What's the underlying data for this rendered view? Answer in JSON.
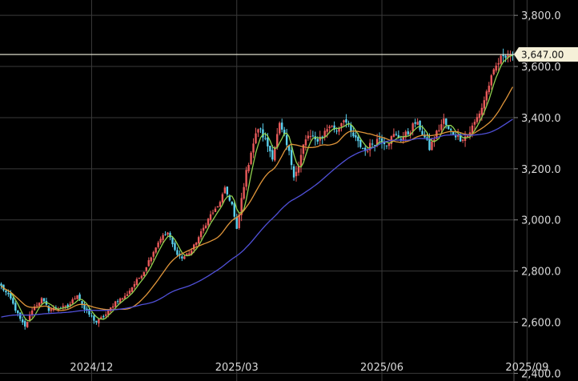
{
  "chart_data": {
    "type": "candlestick",
    "title": "",
    "xlabel": "",
    "ylabel": "",
    "ylim": [
      2370,
      3860
    ],
    "grid": true,
    "y_ticks": [
      {
        "value": 2400,
        "label": "2,400.0"
      },
      {
        "value": 2600,
        "label": "2,600.0"
      },
      {
        "value": 2800,
        "label": "2,800.0"
      },
      {
        "value": 3000,
        "label": "3,000.0"
      },
      {
        "value": 3200,
        "label": "3,200.0"
      },
      {
        "value": 3400,
        "label": "3,400.0"
      },
      {
        "value": 3600,
        "label": "3,600.0"
      },
      {
        "value": 3800,
        "label": "3,800.0"
      }
    ],
    "x_ticks": [
      {
        "label": "2024/12",
        "index": 38
      },
      {
        "label": "2025/03",
        "index": 99
      },
      {
        "label": "2025/06",
        "index": 160
      },
      {
        "label": "2025/09",
        "index": 221
      }
    ],
    "current_price": {
      "value": 3647.0,
      "label": "3,647.00"
    },
    "colors": {
      "up": "#e85a5a",
      "down": "#5ad0ee",
      "ma_short": "#8fd14f",
      "ma_mid": "#e0953a",
      "ma_long": "#5050d8",
      "price_line": "#f2f2e0",
      "price_box": "#f5f0d8"
    },
    "series": [
      {
        "name": "",
        "color": "#8fd14f",
        "window": 5
      },
      {
        "name": "",
        "color": "#e0953a",
        "window": 20
      },
      {
        "name": "",
        "color": "#5050d8",
        "window": 60
      }
    ],
    "price_anchors": [
      [
        0,
        2740
      ],
      [
        4,
        2690
      ],
      [
        8,
        2610
      ],
      [
        10,
        2580
      ],
      [
        13,
        2650
      ],
      [
        17,
        2690
      ],
      [
        20,
        2650
      ],
      [
        28,
        2660
      ],
      [
        32,
        2710
      ],
      [
        35,
        2650
      ],
      [
        40,
        2600
      ],
      [
        44,
        2630
      ],
      [
        48,
        2680
      ],
      [
        52,
        2700
      ],
      [
        56,
        2750
      ],
      [
        60,
        2800
      ],
      [
        63,
        2860
      ],
      [
        67,
        2930
      ],
      [
        70,
        2950
      ],
      [
        73,
        2880
      ],
      [
        76,
        2850
      ],
      [
        80,
        2880
      ],
      [
        84,
        2950
      ],
      [
        88,
        3020
      ],
      [
        91,
        3050
      ],
      [
        94,
        3120
      ],
      [
        97,
        3060
      ],
      [
        99,
        2960
      ],
      [
        102,
        3140
      ],
      [
        105,
        3270
      ],
      [
        108,
        3360
      ],
      [
        110,
        3330
      ],
      [
        112,
        3290
      ],
      [
        114,
        3250
      ],
      [
        117,
        3370
      ],
      [
        119,
        3320
      ],
      [
        121,
        3260
      ],
      [
        123,
        3180
      ],
      [
        125,
        3210
      ],
      [
        127,
        3290
      ],
      [
        129,
        3330
      ],
      [
        132,
        3310
      ],
      [
        135,
        3330
      ],
      [
        138,
        3370
      ],
      [
        141,
        3350
      ],
      [
        144,
        3400
      ],
      [
        147,
        3340
      ],
      [
        150,
        3300
      ],
      [
        153,
        3270
      ],
      [
        156,
        3300
      ],
      [
        159,
        3320
      ],
      [
        162,
        3300
      ],
      [
        165,
        3330
      ],
      [
        168,
        3320
      ],
      [
        171,
        3340
      ],
      [
        174,
        3380
      ],
      [
        176,
        3360
      ],
      [
        178,
        3320
      ],
      [
        180,
        3280
      ],
      [
        183,
        3340
      ],
      [
        186,
        3390
      ],
      [
        188,
        3350
      ],
      [
        190,
        3340
      ],
      [
        193,
        3320
      ],
      [
        196,
        3330
      ],
      [
        199,
        3380
      ],
      [
        202,
        3440
      ],
      [
        205,
        3530
      ],
      [
        208,
        3600
      ],
      [
        211,
        3647
      ]
    ]
  }
}
